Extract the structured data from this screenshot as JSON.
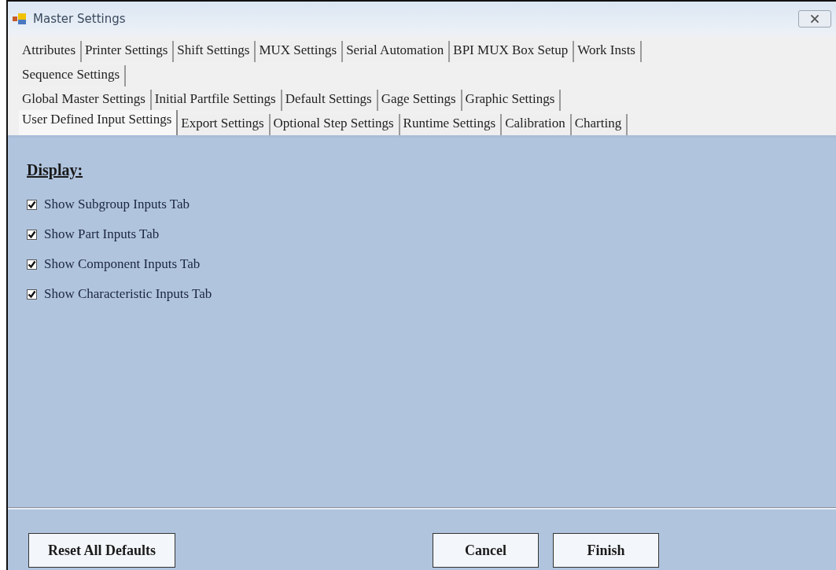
{
  "window": {
    "title": "Master Settings"
  },
  "tab_rows": [
    [
      {
        "label": "Attributes",
        "selected": false
      },
      {
        "label": "Printer Settings",
        "selected": false
      },
      {
        "label": "Shift Settings",
        "selected": false
      },
      {
        "label": "MUX Settings",
        "selected": false
      },
      {
        "label": "Serial Automation",
        "selected": false
      },
      {
        "label": "BPI MUX Box Setup",
        "selected": false
      },
      {
        "label": "Work Insts",
        "selected": false
      }
    ],
    [
      {
        "label": "Sequence Settings",
        "selected": false
      }
    ],
    [
      {
        "label": "Global Master Settings",
        "selected": false
      },
      {
        "label": "Initial Partfile Settings",
        "selected": false
      },
      {
        "label": "Default Settings",
        "selected": false
      },
      {
        "label": "Gage Settings",
        "selected": false
      },
      {
        "label": "Graphic Settings",
        "selected": false
      }
    ],
    [
      {
        "label": "User Defined Input Settings",
        "selected": true
      },
      {
        "label": "Export Settings",
        "selected": false
      },
      {
        "label": "Optional Step Settings",
        "selected": false
      },
      {
        "label": "Runtime Settings",
        "selected": false
      },
      {
        "label": "Calibration",
        "selected": false
      },
      {
        "label": "Charting",
        "selected": false
      }
    ]
  ],
  "section": {
    "heading": "Display:",
    "options": [
      {
        "label": "Show Subgroup Inputs Tab",
        "checked": true
      },
      {
        "label": "Show Part Inputs Tab",
        "checked": true
      },
      {
        "label": "Show Component Inputs Tab",
        "checked": true
      },
      {
        "label": "Show Characteristic Inputs Tab",
        "checked": true
      }
    ]
  },
  "buttons": {
    "left": [
      "Reset All Defaults"
    ],
    "right": [
      "Cancel",
      "Finish"
    ]
  }
}
